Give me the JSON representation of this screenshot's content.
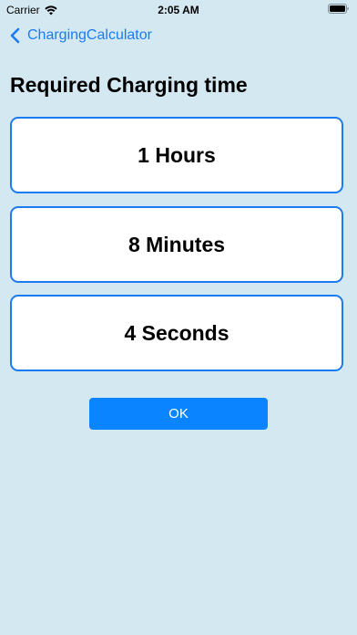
{
  "status_bar": {
    "carrier": "Carrier",
    "time": "2:05 AM"
  },
  "nav": {
    "back_label": "ChargingCalculator"
  },
  "main": {
    "title": "Required Charging time",
    "hours": "1 Hours",
    "minutes": "8 Minutes",
    "seconds": "4 Seconds",
    "ok_label": "OK"
  },
  "colors": {
    "background": "#d4e8f2",
    "accent": "#1a7cf0",
    "button": "#0a84ff"
  },
  "icons": [
    "wifi-icon",
    "battery-icon",
    "chevron-left-icon"
  ]
}
